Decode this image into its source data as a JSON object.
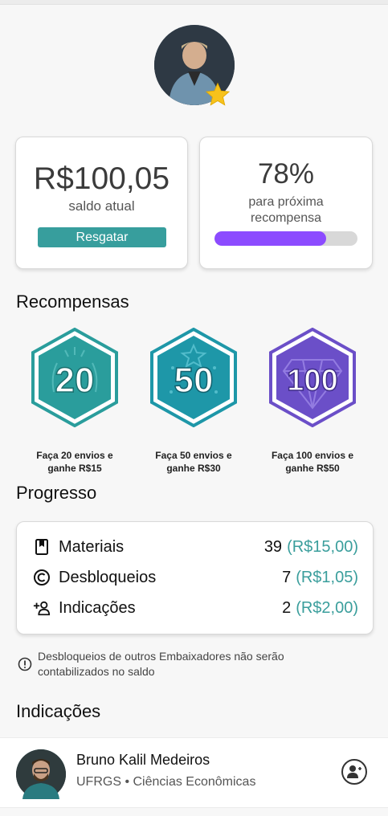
{
  "wallet": {
    "balance": "R$100,05",
    "balance_label": "saldo atual",
    "redeem_label": "Resgatar"
  },
  "next_reward": {
    "percent_text": "78%",
    "label_line1": "para próxima",
    "label_line2": "recompensa",
    "progress_fraction": 0.78,
    "accent_color": "#8c4bff"
  },
  "rewards": {
    "title": "Recompensas",
    "items": [
      {
        "badge_text": "20",
        "caption_line1": "Faça 20 envios e",
        "caption_line2": "ganhe R$15",
        "color": "#2a9d9c",
        "icon": "leaf-badge-icon"
      },
      {
        "badge_text": "50",
        "caption_line1": "Faça 50 envios e",
        "caption_line2": "ganhe R$30",
        "color": "#1e97a8",
        "icon": "star-badge-icon"
      },
      {
        "badge_text": "100",
        "caption_line1": "Faça 100 envios e",
        "caption_line2": "ganhe R$50",
        "color": "#6b4fc8",
        "icon": "diamond-badge-icon"
      }
    ]
  },
  "progress": {
    "title": "Progresso",
    "rows": [
      {
        "icon": "bookmark-icon",
        "label": "Materiais",
        "count": "39",
        "money": "(R$15,00)"
      },
      {
        "icon": "copyright-icon",
        "label": "Desbloqueios",
        "count": "7",
        "money": "(R$1,05)"
      },
      {
        "icon": "add-person-icon",
        "label": "Indicações",
        "count": "2",
        "money": "(R$2,00)"
      }
    ],
    "note_line1": "Desbloqueios de outros Embaixadores não serão",
    "note_line2": "contabilizados no saldo"
  },
  "referrals": {
    "title": "Indicações",
    "items": [
      {
        "name": "Bruno Kalil Medeiros",
        "subtitle": "UFRGS • Ciências Econômicas"
      }
    ]
  },
  "colors": {
    "teal": "#379e9d",
    "purple": "#8c4bff"
  }
}
